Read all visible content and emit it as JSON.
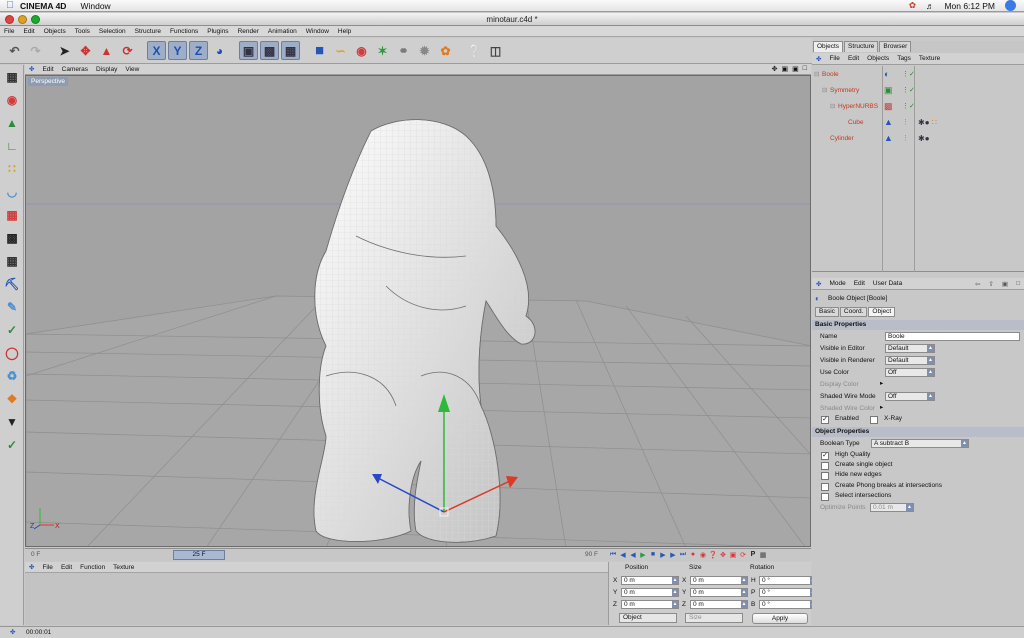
{
  "macbar": {
    "app_name": "CINEMA 4D",
    "menu_window": "Window",
    "clock": "Mon 6:12 PM"
  },
  "window": {
    "title": "minotaur.c4d *"
  },
  "app_menu": [
    "File",
    "Edit",
    "Objects",
    "Tools",
    "Selection",
    "Structure",
    "Functions",
    "Plugins",
    "Render",
    "Animation",
    "Window",
    "Help"
  ],
  "viewport": {
    "menu": [
      "Edit",
      "Cameras",
      "Display",
      "View"
    ],
    "camera_label": "Perspective",
    "axis_z": "Z",
    "axis_x": "X"
  },
  "timeline": {
    "start": "0 F",
    "current": "25 F",
    "end": "90 F"
  },
  "material_menu": [
    "File",
    "Edit",
    "Function",
    "Texture"
  ],
  "coords": {
    "headers": {
      "position": "Position",
      "size": "Size",
      "rotation": "Rotation"
    },
    "rows": [
      {
        "axis": "X",
        "pos": "0 m",
        "size_axis": "X",
        "size": "0 m",
        "rot_axis": "H",
        "rot": "0 °"
      },
      {
        "axis": "Y",
        "pos": "0 m",
        "size_axis": "Y",
        "size": "0 m",
        "rot_axis": "P",
        "rot": "0 °"
      },
      {
        "axis": "Z",
        "pos": "0 m",
        "size_axis": "Z",
        "size": "0 m",
        "rot_axis": "B",
        "rot": "0 °"
      }
    ],
    "mode_select": "Object",
    "size_select": "Size",
    "apply": "Apply"
  },
  "status": {
    "time": "00:00:01"
  },
  "object_manager": {
    "tabs": [
      "Objects",
      "Structure",
      "Browser"
    ],
    "menu": [
      "File",
      "Edit",
      "Objects",
      "Tags",
      "Texture"
    ],
    "objects": [
      {
        "name": "Boole",
        "indent": 0
      },
      {
        "name": "Symmetry",
        "indent": 1
      },
      {
        "name": "HyperNURBS",
        "indent": 2
      },
      {
        "name": "Cube",
        "indent": 3
      },
      {
        "name": "Cylinder",
        "indent": 1
      }
    ]
  },
  "attributes": {
    "menu": [
      "Mode",
      "Edit",
      "User Data"
    ],
    "title": "Boole Object [Boole]",
    "tabs": [
      "Basic",
      "Coord.",
      "Object"
    ],
    "basic_header": "Basic Properties",
    "name_label": "Name",
    "name_value": "Boole",
    "visible_editor_label": "Visible in Editor",
    "visible_editor_value": "Default",
    "visible_renderer_label": "Visible in Renderer",
    "visible_renderer_value": "Default",
    "use_color_label": "Use Color",
    "use_color_value": "Off",
    "display_color_label": "Display Color",
    "shaded_wire_label": "Shaded Wire Mode",
    "shaded_wire_value": "Off",
    "shaded_wire_color_label": "Shaded Wire Color",
    "enabled_label": "Enabled",
    "xray_label": "X-Ray",
    "object_header": "Object Properties",
    "boolean_type_label": "Boolean Type",
    "boolean_type_value": "A subtract B",
    "high_quality_label": "High Quality",
    "create_single_label": "Create single object",
    "hide_edges_label": "Hide new edges",
    "phong_label": "Create Phong breaks at intersections",
    "select_intersections_label": "Select intersections",
    "optimize_label": "Optimize Points",
    "optimize_value": "0.01 m"
  },
  "colors": {
    "accent_blue": "#1d4fb2",
    "object_name": "#c23a1d",
    "viewport_bg": "#a3a3a3"
  }
}
